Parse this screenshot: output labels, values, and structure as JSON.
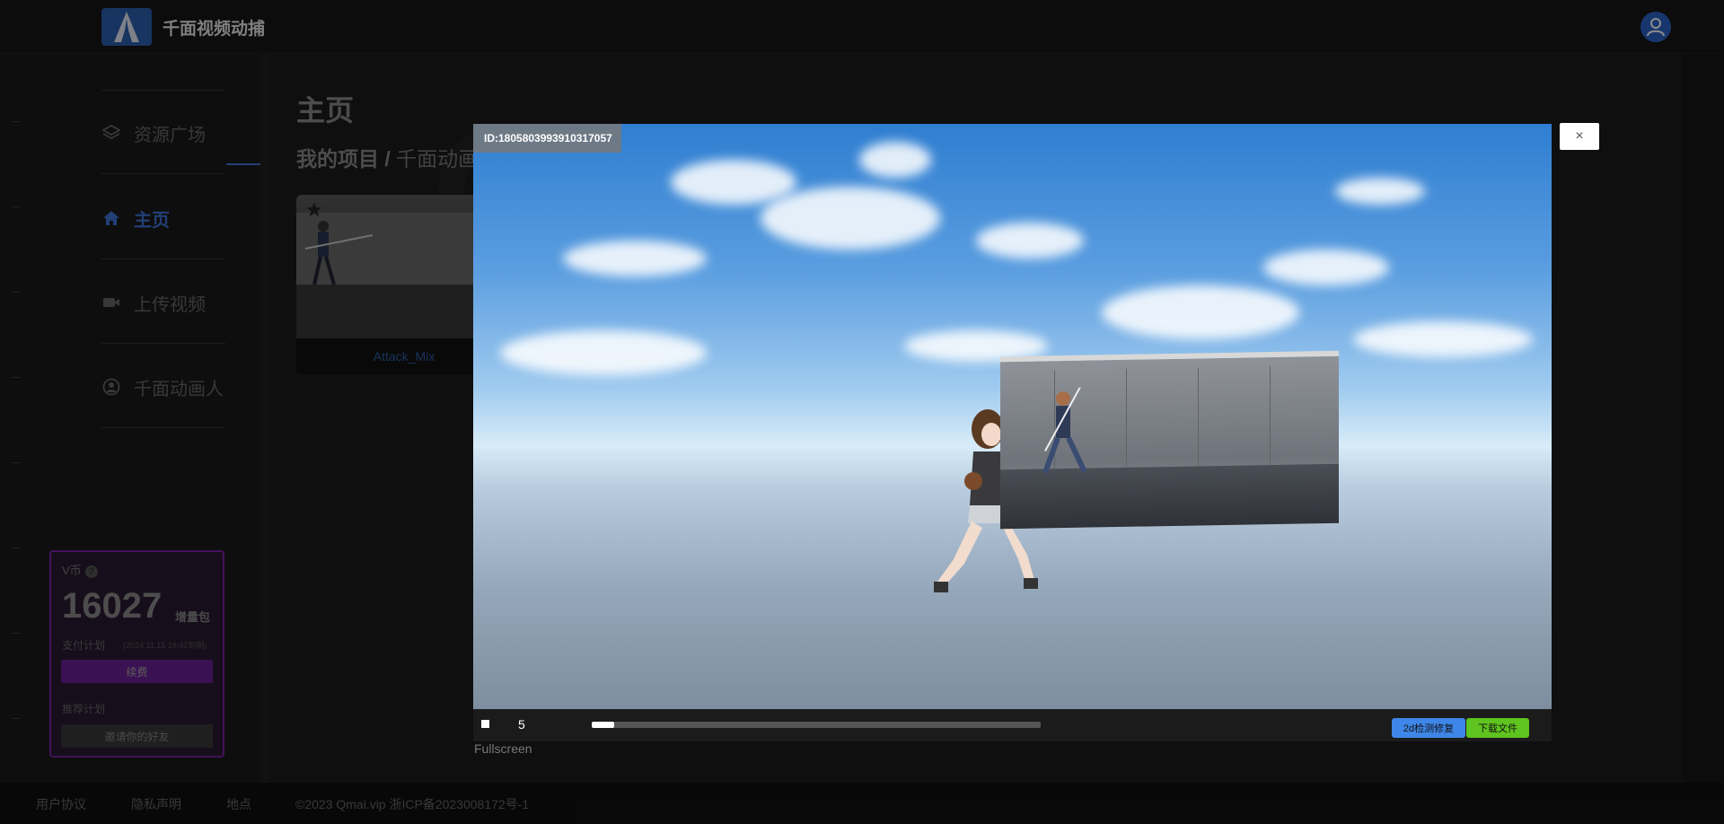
{
  "header": {
    "brand": "千面视频动捕"
  },
  "sidebar": {
    "items": [
      {
        "label": "资源广场",
        "icon": "layers-icon"
      },
      {
        "label": "主页",
        "icon": "home-icon",
        "active": true
      },
      {
        "label": "上传视频",
        "icon": "video-camera-icon"
      },
      {
        "label": "千面动画人",
        "icon": "user-circle-icon"
      }
    ]
  },
  "vcoin": {
    "label": "V币",
    "help": "?",
    "amount": "16027",
    "pack": "增量包",
    "plan_label": "支付计划",
    "plan_date": "(2024.11.15 16:42到期)",
    "renew": "续费",
    "referral_label": "推荐计划",
    "invite": "邀请你的好友"
  },
  "main": {
    "title": "主页",
    "breadcrumb_root": "我的项目",
    "breadcrumb_sep": " / ",
    "breadcrumb_current": "千面动画",
    "cards": [
      {
        "caption": "Attack_Mix"
      }
    ]
  },
  "modal": {
    "id_tag": "ID:1805803993910317057",
    "close": "×",
    "frame": "5",
    "progress": 0.05,
    "btn_fix": "2d检测修复",
    "btn_download": "下载文件",
    "fullscreen": "Fullscreen"
  },
  "footer": {
    "agreement": "用户协议",
    "privacy": "隐私声明",
    "location": "地点",
    "copyright": "©2023 Qmai.vip 浙ICP备2023008172号-1"
  },
  "colors": {
    "accent": "#3f74d8",
    "purple": "#7a22a8",
    "green": "#5fc41f",
    "blue_btn": "#3e86e8"
  }
}
